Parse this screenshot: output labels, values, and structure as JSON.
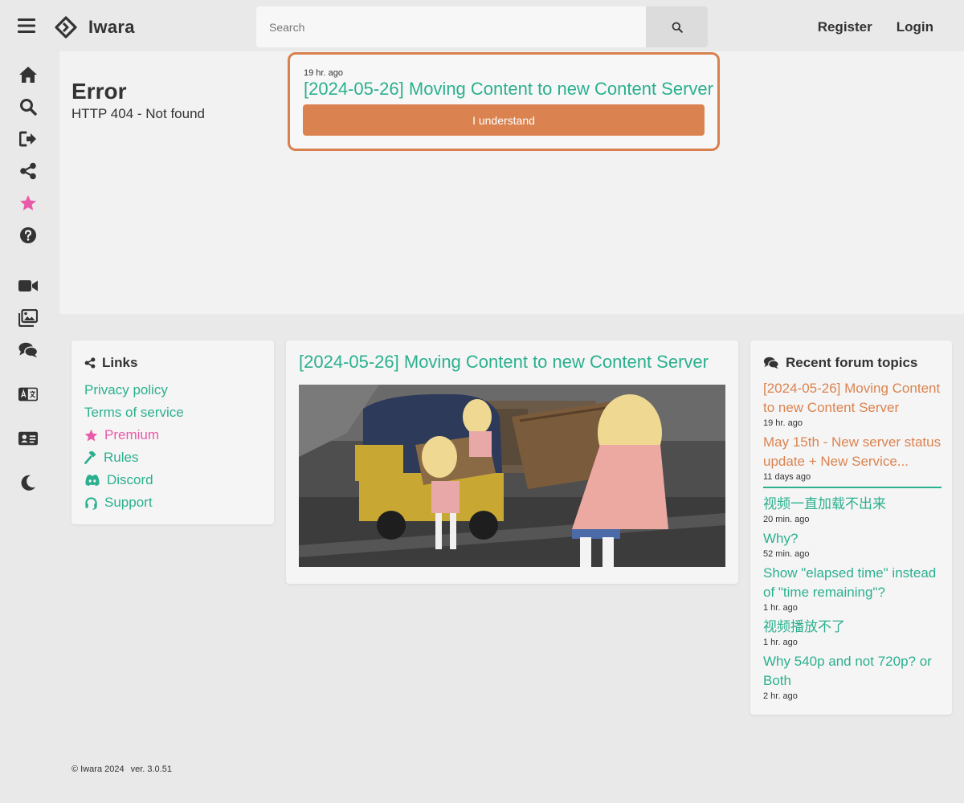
{
  "header": {
    "site_name": "Iwara",
    "search_placeholder": "Search",
    "register_label": "Register",
    "login_label": "Login"
  },
  "sidebar": {
    "items": [
      {
        "icon": "home-icon"
      },
      {
        "icon": "search-icon"
      },
      {
        "icon": "sign-out-icon"
      },
      {
        "icon": "share-icon"
      },
      {
        "icon": "star-icon",
        "color": "#e95aa9"
      },
      {
        "icon": "question-circle-icon"
      },
      {
        "icon": "video-camera-icon"
      },
      {
        "icon": "images-icon"
      },
      {
        "icon": "comments-icon"
      },
      {
        "icon": "language-icon"
      },
      {
        "icon": "id-card-icon"
      },
      {
        "icon": "moon-icon"
      }
    ]
  },
  "error": {
    "title": "Error",
    "message": "HTTP 404 - Not found"
  },
  "announcement": {
    "time": "19 hr. ago",
    "title": "[2024-05-26] Moving Content to new Content Server",
    "button_label": "I understand"
  },
  "links": {
    "heading": "Links",
    "items": [
      {
        "label": "Privacy policy"
      },
      {
        "label": "Terms of service"
      },
      {
        "label": "Premium",
        "icon": "star-icon"
      },
      {
        "label": "Rules",
        "icon": "gavel-icon"
      },
      {
        "label": "Discord",
        "icon": "discord-icon"
      },
      {
        "label": "Support",
        "icon": "headset-icon"
      }
    ]
  },
  "news": {
    "title": "[2024-05-26] Moving Content to new Content Server"
  },
  "forum": {
    "heading": "Recent forum topics",
    "pinned": [
      {
        "title": "[2024-05-26] Moving Content to new Content Server",
        "time": "19 hr. ago"
      },
      {
        "title": "May 15th - New server status update + New Service...",
        "time": "11 days ago"
      }
    ],
    "recent": [
      {
        "title": "视频一直加载不出来",
        "time": "20 min. ago"
      },
      {
        "title": "Why?",
        "time": "52 min. ago"
      },
      {
        "title": "Show \"elapsed time\" instead of \"time remaining\"?",
        "time": "1 hr. ago"
      },
      {
        "title": "视频播放不了",
        "time": "1 hr. ago"
      },
      {
        "title": "Why 540p and not 720p? or Both",
        "time": "2 hr. ago"
      }
    ]
  },
  "footer": {
    "copyright": "© Iwara 2024",
    "version": "ver. 3.0.51"
  },
  "colors": {
    "accent": "#2bb08f",
    "orange": "#db8350",
    "pink": "#e95aa9"
  }
}
